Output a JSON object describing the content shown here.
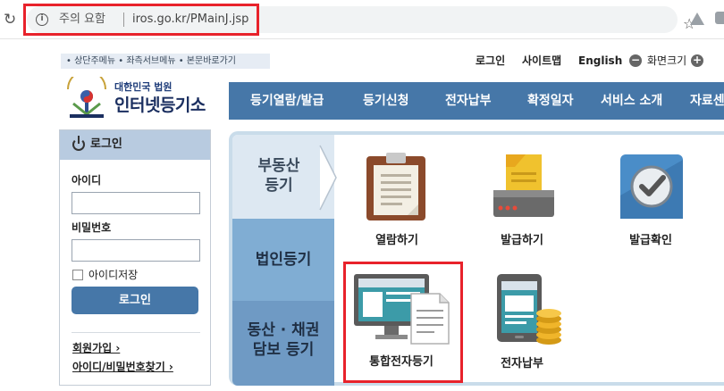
{
  "browser": {
    "security_warning": "주의 요함",
    "url": "iros.go.kr/PMainJ.jsp"
  },
  "utility": {
    "skip_links": "• 상단주메뉴 • 좌측서브메뉴 • 본문바로가기",
    "login": "로그인",
    "sitemap": "사이트맵",
    "english": "English",
    "zoom_label": "화면크기"
  },
  "logo": {
    "subtitle": "대한민국 법원",
    "title": "인터넷등기소"
  },
  "nav": {
    "items": [
      {
        "label": "등기열람/발급"
      },
      {
        "label": "등기신청"
      },
      {
        "label": "전자납부"
      },
      {
        "label": "확정일자"
      },
      {
        "label": "서비스 소개"
      },
      {
        "label": "자료센"
      }
    ]
  },
  "login_panel": {
    "title": "로그인",
    "id_label": "아이디",
    "id_value": "",
    "pw_label": "비밀번호",
    "pw_value": "",
    "save_id_label": "아이디저장",
    "login_button": "로그인",
    "signup_link": "회원가입 ›",
    "find_link": "아이디/비밀번호찾기 ›"
  },
  "categories": {
    "real_estate_line1": "부동산",
    "real_estate_line2": "등기",
    "corporate": "법인등기",
    "movable_line1": "동산 · 채권",
    "movable_line2": "담보 등기"
  },
  "services": [
    {
      "label": "열람하기",
      "icon": "clipboard-icon"
    },
    {
      "label": "발급하기",
      "icon": "printer-icon"
    },
    {
      "label": "발급확인",
      "icon": "check-badge-icon"
    },
    {
      "label": "통합전자등기",
      "icon": "monitor-document-icon"
    },
    {
      "label": "전자납부",
      "icon": "tablet-coins-icon"
    }
  ],
  "colors": {
    "nav_bg": "#4677a8",
    "highlight": "#e8222b",
    "category_real": "#dde8f2",
    "category_corp": "#80add3",
    "category_movable": "#6f9ac4"
  }
}
